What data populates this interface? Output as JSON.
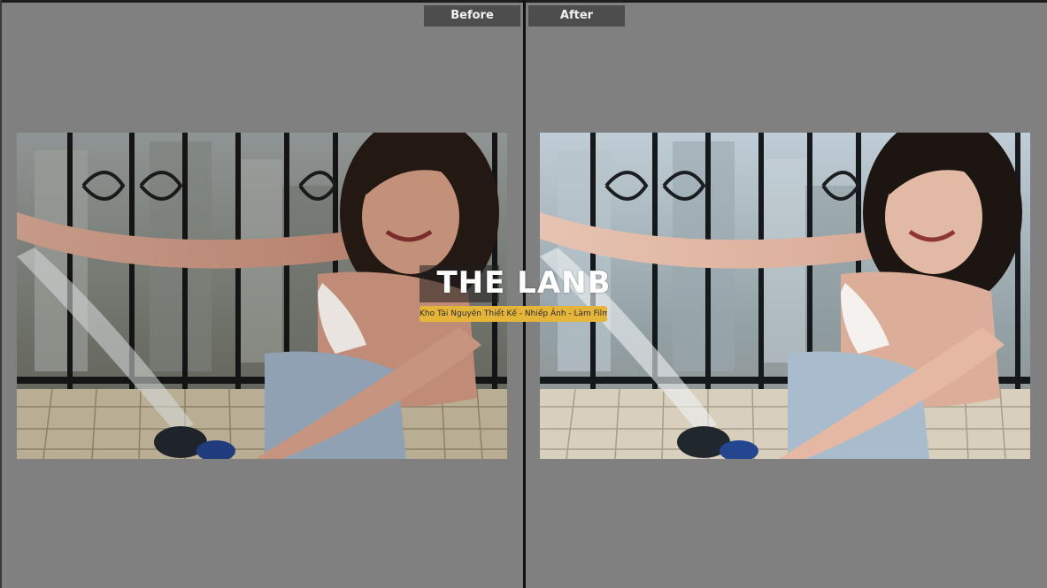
{
  "labels": {
    "before": "Before",
    "after": "After"
  },
  "watermark": {
    "logo_text": "THE LANB",
    "tagline": "Kho Tài Nguyên Thiết Kế - Nhiếp Ảnh - Làm Film"
  },
  "colors": {
    "background": "#808080",
    "label_bg": "#4d4d4d",
    "divider": "#111111",
    "watermark_tag": "#e5b53a"
  },
  "photo": {
    "subject": "smiling woman on balcony holding water hose",
    "before_grade": "darker, warmer original",
    "after_grade": "brighter, cooler edited"
  }
}
